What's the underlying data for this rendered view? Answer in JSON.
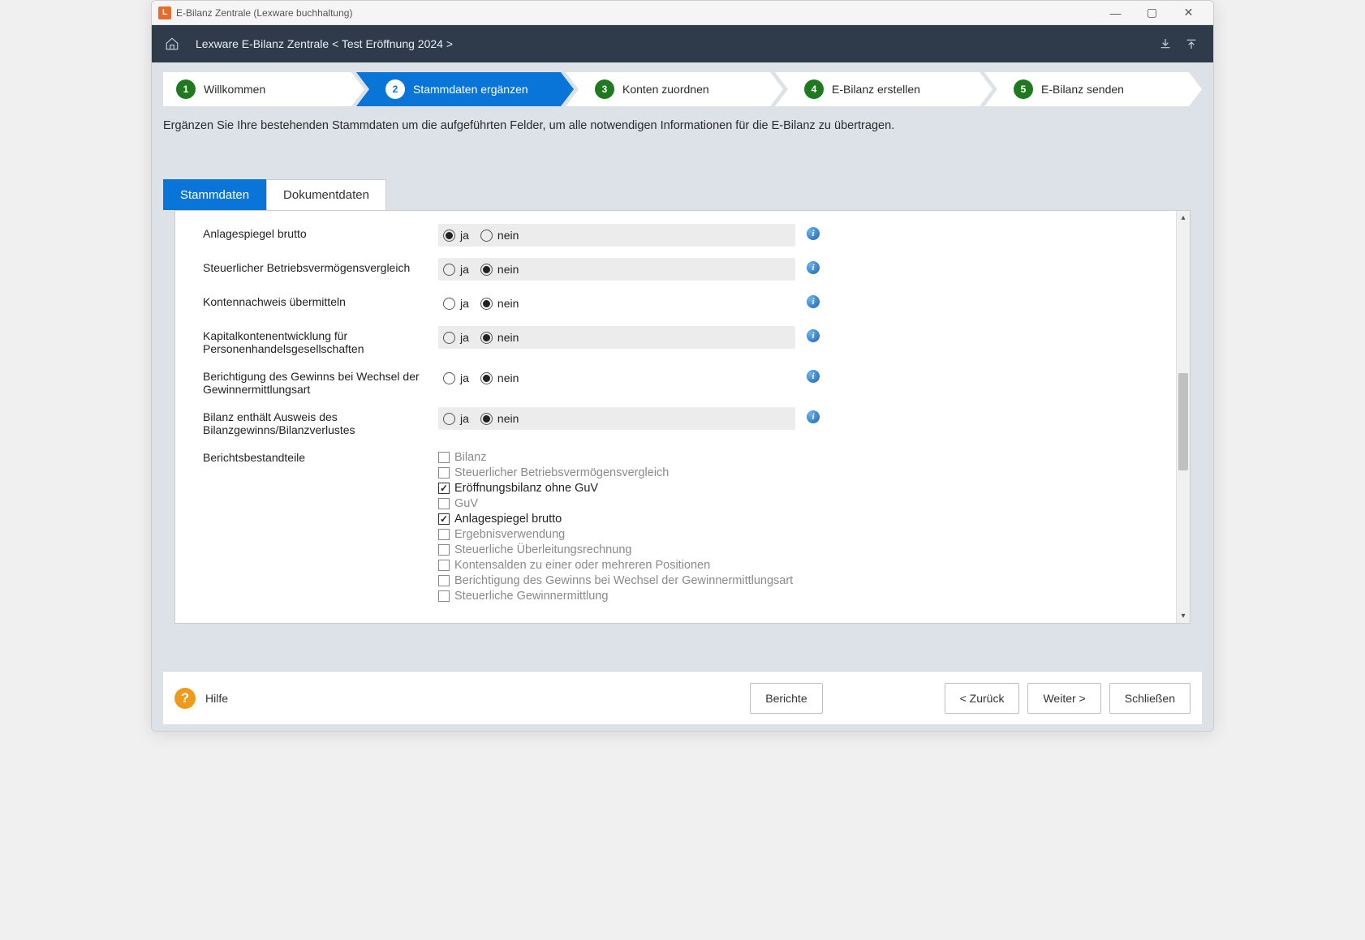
{
  "window": {
    "title": "E-Bilanz Zentrale (Lexware buchhaltung)"
  },
  "header": {
    "breadcrumb": "Lexware E-Bilanz Zentrale < Test Eröffnung 2024 >"
  },
  "wizard": {
    "steps": [
      {
        "num": "1",
        "label": "Willkommen"
      },
      {
        "num": "2",
        "label": "Stammdaten ergänzen"
      },
      {
        "num": "3",
        "label": "Konten zuordnen"
      },
      {
        "num": "4",
        "label": "E-Bilanz erstellen"
      },
      {
        "num": "5",
        "label": "E-Bilanz senden"
      }
    ],
    "active_index": 1
  },
  "instruction": "Ergänzen Sie Ihre bestehenden Stammdaten um die aufgeführten Felder, um alle notwendigen Informationen für die E-Bilanz zu übertragen.",
  "tabs": {
    "items": [
      {
        "label": "Stammdaten"
      },
      {
        "label": "Dokumentdaten"
      }
    ],
    "active_index": 0
  },
  "form": {
    "yes": "ja",
    "no": "nein",
    "rows": [
      {
        "label": "Anlagespiegel brutto",
        "value": "ja",
        "shaded": true
      },
      {
        "label": "Steuerlicher Betriebsvermögensvergleich",
        "value": "nein",
        "shaded": true
      },
      {
        "label": "Kontennachweis übermitteln",
        "value": "nein",
        "shaded": false
      },
      {
        "label": "Kapitalkontenentwicklung für Personenhandelsgesellschaften",
        "value": "nein",
        "shaded": true
      },
      {
        "label": "Berichtigung des Gewinns bei Wechsel der Gewinnermittlungsart",
        "value": "nein",
        "shaded": false
      },
      {
        "label": "Bilanz enthält Ausweis des Bilanzgewinns/Bilanzverlustes",
        "value": "nein",
        "shaded": true
      }
    ],
    "checklist": {
      "label": "Berichtsbestandteile",
      "items": [
        {
          "label": "Bilanz",
          "checked": false,
          "enabled": false
        },
        {
          "label": "Steuerlicher Betriebsvermögensvergleich",
          "checked": false,
          "enabled": false
        },
        {
          "label": "Eröffnungsbilanz ohne GuV",
          "checked": true,
          "enabled": true
        },
        {
          "label": "GuV",
          "checked": false,
          "enabled": false
        },
        {
          "label": "Anlagespiegel brutto",
          "checked": true,
          "enabled": true
        },
        {
          "label": "Ergebnisverwendung",
          "checked": false,
          "enabled": false
        },
        {
          "label": "Steuerliche Überleitungsrechnung",
          "checked": false,
          "enabled": false
        },
        {
          "label": "Kontensalden zu einer oder mehreren Positionen",
          "checked": false,
          "enabled": false
        },
        {
          "label": "Berichtigung des Gewinns bei Wechsel der Gewinnermittlungsart",
          "checked": false,
          "enabled": false
        },
        {
          "label": "Steuerliche Gewinnermittlung",
          "checked": false,
          "enabled": false
        }
      ]
    }
  },
  "footer": {
    "help": "Hilfe",
    "reports": "Berichte",
    "back": "< Zurück",
    "next": "Weiter >",
    "close": "Schließen"
  }
}
